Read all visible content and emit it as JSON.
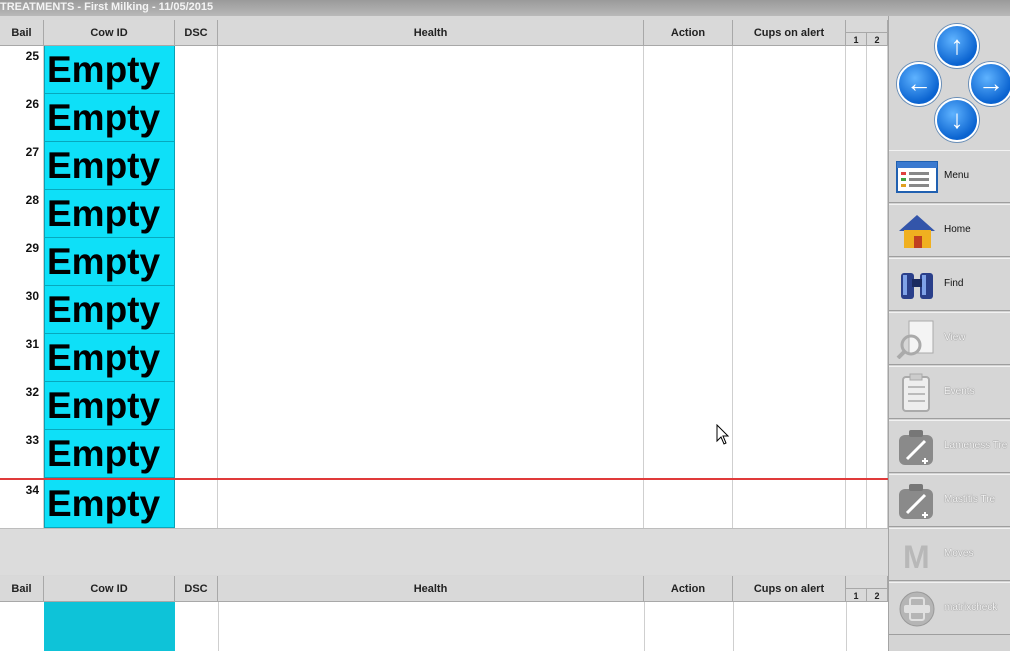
{
  "window": {
    "title": "TREATMENTS - First Milking - 11/05/2015"
  },
  "columns": {
    "bail": "Bail",
    "cow_id": "Cow ID",
    "dsc": "DSC",
    "health": "Health",
    "action": "Action",
    "cups_on_alert": "Cups on alert",
    "cup1": "1",
    "cup2": "2"
  },
  "rows": [
    {
      "bail": "25",
      "cow_id": "Empty"
    },
    {
      "bail": "26",
      "cow_id": "Empty"
    },
    {
      "bail": "27",
      "cow_id": "Empty"
    },
    {
      "bail": "28",
      "cow_id": "Empty"
    },
    {
      "bail": "29",
      "cow_id": "Empty"
    },
    {
      "bail": "30",
      "cow_id": "Empty"
    },
    {
      "bail": "31",
      "cow_id": "Empty"
    },
    {
      "bail": "32",
      "cow_id": "Empty"
    },
    {
      "bail": "33",
      "cow_id": "Empty"
    },
    {
      "bail": "34",
      "cow_id": "Empty"
    }
  ],
  "selected_bail": "34",
  "sidebar": {
    "nav_arrows": [
      "up-arrow-icon",
      "left-arrow-icon",
      "right-arrow-icon",
      "down-arrow-icon"
    ],
    "buttons": [
      {
        "label": "Menu",
        "icon": "menu-icon",
        "enabled": true
      },
      {
        "label": "Home",
        "icon": "home-icon",
        "enabled": true
      },
      {
        "label": "Find",
        "icon": "binoculars-icon",
        "enabled": true
      },
      {
        "label": "View",
        "icon": "magnifier-icon",
        "enabled": false
      },
      {
        "label": "Events",
        "icon": "clipboard-icon",
        "enabled": false
      },
      {
        "label": "Lameness Tre",
        "icon": "medical-kit-icon",
        "enabled": false
      },
      {
        "label": "Mastitis Tre",
        "icon": "medical-kit-icon",
        "enabled": false
      },
      {
        "label": "Moves",
        "icon": "moves-m-icon",
        "enabled": false
      },
      {
        "label": "matrixcheck",
        "icon": "matrixcheck-icon",
        "enabled": false
      }
    ]
  },
  "colors": {
    "cow_id_bg": "#0ee0f8",
    "selection_border": "#e03a3a",
    "nav_arrow": "#0a63d0"
  }
}
